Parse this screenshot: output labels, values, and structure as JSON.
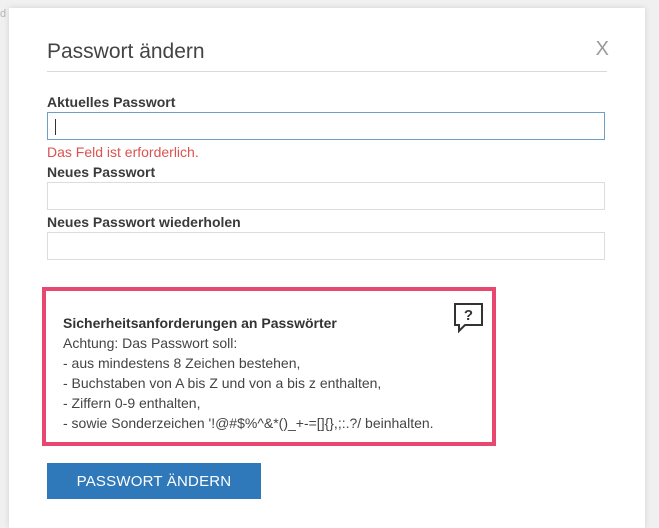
{
  "background": {
    "stray_char": "d"
  },
  "dialog": {
    "title": "Passwort ändern",
    "close_label": "X"
  },
  "form": {
    "current_password": {
      "label": "Aktuelles Passwort",
      "value": "",
      "error": "Das Feld ist erforderlich."
    },
    "new_password": {
      "label": "Neues Passwort",
      "value": ""
    },
    "repeat_password": {
      "label": "Neues Passwort wiederholen",
      "value": ""
    }
  },
  "requirements": {
    "title": "Sicherheitsanforderungen an Passwörter",
    "lines": [
      "Achtung: Das Passwort soll:",
      "- aus mindestens 8 Zeichen bestehen,",
      "- Buchstaben von A bis Z und von a bis z enthalten,",
      "- Ziffern 0-9 enthalten,",
      "- sowie Sonderzeichen '!@#$%^&*()_+-=[]{},;:.?/ beinhalten."
    ],
    "help_icon": "help-speech-bubble-icon",
    "help_symbol": "?",
    "highlight_color": "#e8486f"
  },
  "actions": {
    "submit_label": "PASSWORT ÄNDERN",
    "submit_color": "#2f79bb"
  }
}
